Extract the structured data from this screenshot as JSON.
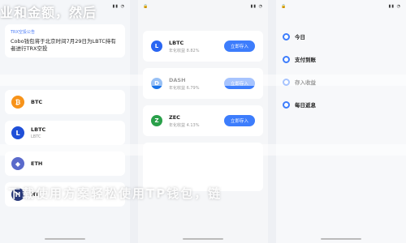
{
  "overlay": {
    "top_text": "业和金额，然后",
    "bottom_text": "下载使用方案轻松使用TP钱包，链"
  },
  "panel1": {
    "news": {
      "tag": "TRX空投公告",
      "text": "Cobo钱包将于北京时间7月29日为LBTC持有者进行TRX空投"
    },
    "coins": [
      {
        "symbol": "BTC",
        "icon": "bitcoin-icon",
        "color": "#f7931a",
        "glyph": "₿"
      },
      {
        "symbol": "LBTC",
        "sub": "LBTC",
        "icon": "lbtc-icon",
        "color": "#1f4fd8",
        "glyph": "L"
      },
      {
        "symbol": "ETH",
        "icon": "ethereum-icon",
        "color": "#5a6acb",
        "glyph": "◆"
      },
      {
        "symbol": "HT",
        "icon": "ht-icon",
        "color": "#2a3a7c",
        "glyph": "H"
      }
    ]
  },
  "panel2": {
    "rows": [
      {
        "symbol": "LBTC",
        "sub": "年化收益 8.82%",
        "button": "立即存入",
        "icon": "lbtc-icon",
        "color": "#2a66f2",
        "glyph": "L"
      },
      {
        "symbol": "DASH",
        "sub": "年化收益 6.79%",
        "button": "立即存入",
        "icon": "dash-icon",
        "color": "#1a73e8",
        "glyph": "D"
      },
      {
        "symbol": "ZEC",
        "sub": "年化收益 4.13%",
        "button": "立即存入",
        "icon": "zec-icon",
        "color": "#2aa04a",
        "glyph": "Z"
      }
    ]
  },
  "panel3": {
    "steps": [
      {
        "label": "今日",
        "sub": ""
      },
      {
        "label": "支付到账",
        "sub": ""
      },
      {
        "label": "存入收益",
        "sub": ""
      },
      {
        "label": "每日返息",
        "sub": ""
      }
    ]
  }
}
